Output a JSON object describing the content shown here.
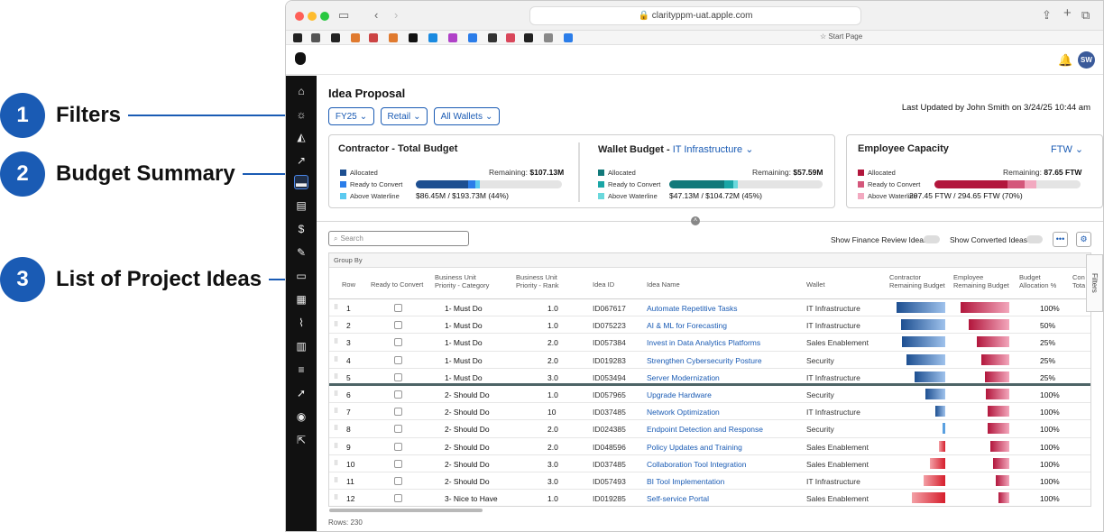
{
  "callouts": [
    {
      "num": "1",
      "label": "Filters"
    },
    {
      "num": "2",
      "label": "Budget Summary"
    },
    {
      "num": "3",
      "label": "List of Project Ideas"
    }
  ],
  "browser": {
    "url": "clarityppm-uat.apple.com",
    "start_page": "Start Page"
  },
  "header": {
    "avatar": "SW"
  },
  "page": {
    "title": "Idea Proposal",
    "last_updated": "Last Updated by John Smith on 3/24/25 10:44 am",
    "filters": [
      "FY25",
      "Retail",
      "All Wallets"
    ]
  },
  "cards": {
    "contractor": {
      "title": "Contractor - Total Budget",
      "legend": [
        "Allocated",
        "Ready to Convert",
        "Above Waterline"
      ],
      "remaining_label": "Remaining:",
      "remaining": "$107.13M",
      "summary": "$86.45M / $193.73M (44%)",
      "fill": [
        0.36,
        0.05,
        0.03
      ]
    },
    "wallet": {
      "title": "Wallet Budget - ",
      "wallet": "IT Infrastructure",
      "legend": [
        "Allocated",
        "Ready to Convert",
        "Above Waterline"
      ],
      "remaining_label": "Remaining:",
      "remaining": "$57.59M",
      "summary": "$47.13M / $104.72M (45%)",
      "fill": [
        0.36,
        0.06,
        0.03
      ]
    },
    "employee": {
      "title": "Employee Capacity",
      "unit": "FTW",
      "legend": [
        "Allocated",
        "Ready to Convert",
        "Above Waterline"
      ],
      "remaining_label": "Remaining:",
      "remaining": "87.65 FTW",
      "summary": "207.45 FTW / 294.65 FTW (70%)",
      "fill": [
        0.5,
        0.12,
        0.08
      ]
    }
  },
  "toolbar": {
    "search_placeholder": "Search",
    "toggle1": "Show Finance Review Ideas",
    "toggle2": "Show Converted Ideas"
  },
  "grid": {
    "group_by": "Group By",
    "columns": [
      "Row",
      "Ready to Convert",
      "Business Unit Priority - Category",
      "Business Unit Priority - Rank",
      "Idea ID",
      "Idea Name",
      "Wallet",
      "Contractor Remaining Budget",
      "Employee Remaining Budget",
      "Budget Allocation %",
      "Con Tota"
    ],
    "rows": [
      {
        "row": "1",
        "cat": "1- Must Do",
        "rank": "1.0",
        "id": "ID067617",
        "name": "Automate Repetitive Tasks",
        "wallet": "IT Infrastructure",
        "contractor": 0.9,
        "employee": 0.9,
        "alloc": "100%"
      },
      {
        "row": "2",
        "cat": "1- Must Do",
        "rank": "1.0",
        "id": "ID075223",
        "name": "AI & ML for Forecasting",
        "wallet": "IT Infrastructure",
        "contractor": 0.82,
        "employee": 0.75,
        "alloc": "50%"
      },
      {
        "row": "3",
        "cat": "1- Must Do",
        "rank": "2.0",
        "id": "ID057384",
        "name": "Invest in Data Analytics Platforms",
        "wallet": "Sales Enablement",
        "contractor": 0.8,
        "employee": 0.6,
        "alloc": "25%"
      },
      {
        "row": "4",
        "cat": "1- Must Do",
        "rank": "2.0",
        "id": "ID019283",
        "name": "Strengthen Cybersecurity Posture",
        "wallet": "Security",
        "contractor": 0.72,
        "employee": 0.52,
        "alloc": "25%"
      },
      {
        "row": "5",
        "cat": "1- Must Do",
        "rank": "3.0",
        "id": "ID053494",
        "name": "Server Modernization",
        "wallet": "IT Infrastructure",
        "contractor": 0.57,
        "employee": 0.45,
        "alloc": "25%"
      },
      {
        "row": "6",
        "cat": "2- Should Do",
        "rank": "1.0",
        "id": "ID057965",
        "name": "Upgrade Hardware",
        "wallet": "Security",
        "contractor": 0.37,
        "employee": 0.44,
        "alloc": "100%"
      },
      {
        "row": "7",
        "cat": "2- Should Do",
        "rank": "10",
        "id": "ID037485",
        "name": "Network Optimization",
        "wallet": "IT Infrastructure",
        "contractor": 0.19,
        "employee": 0.4,
        "alloc": "100%"
      },
      {
        "row": "8",
        "cat": "2- Should Do",
        "rank": "2.0",
        "id": "ID024385",
        "name": "Endpoint Detection and Response",
        "wallet": "Security",
        "contractor": 0.05,
        "employee": 0.4,
        "alloc": "100%"
      },
      {
        "row": "9",
        "cat": "2- Should Do",
        "rank": "2.0",
        "id": "ID048596",
        "name": "Policy Updates and Training",
        "wallet": "Sales Enablement",
        "contractor": 0.12,
        "employee": 0.35,
        "alloc": "100%"
      },
      {
        "row": "10",
        "cat": "2- Should Do",
        "rank": "3.0",
        "id": "ID037485",
        "name": "Collaboration Tool Integration",
        "wallet": "Sales Enablement",
        "contractor": 0.28,
        "employee": 0.3,
        "alloc": "100%"
      },
      {
        "row": "11",
        "cat": "2- Should Do",
        "rank": "3.0",
        "id": "ID057493",
        "name": "BI Tool Implementation",
        "wallet": "IT Infrastructure",
        "contractor": 0.4,
        "employee": 0.25,
        "alloc": "100%"
      },
      {
        "row": "12",
        "cat": "3- Nice to Have",
        "rank": "1.0",
        "id": "ID019285",
        "name": "Self-service Portal",
        "wallet": "Sales Enablement",
        "contractor": 0.62,
        "employee": 0.2,
        "alloc": "100%"
      }
    ],
    "rows_count": "Rows: 230",
    "filters_tab": "Filters"
  },
  "colors": {
    "accent": "#1a5bb4",
    "contractor": "#1d4f91",
    "wallet": "#1a9a9a",
    "employee": "#b2163c"
  }
}
